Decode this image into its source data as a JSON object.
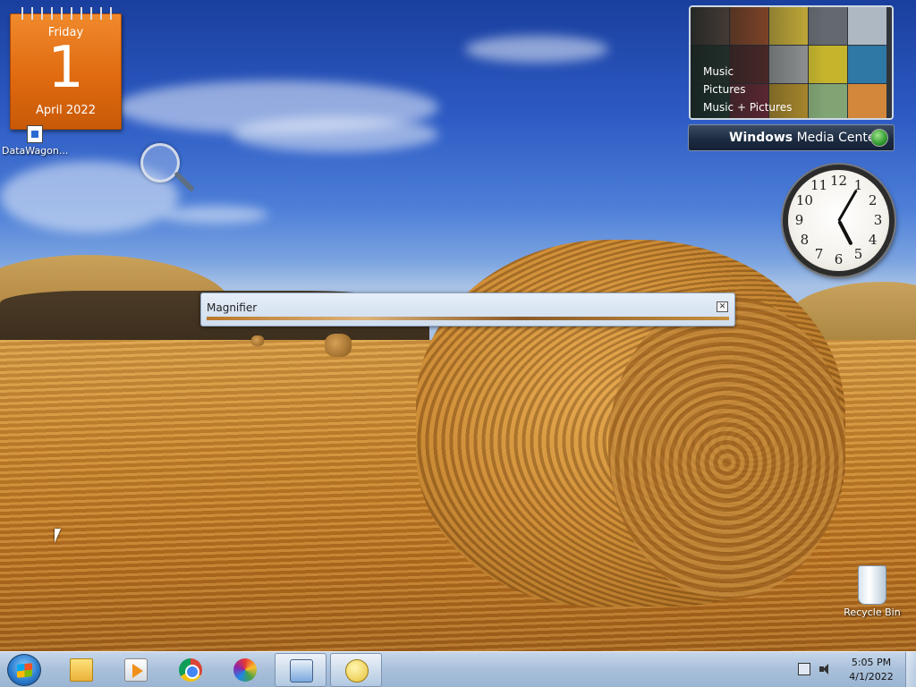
{
  "calendar": {
    "weekday": "Friday",
    "day": "1",
    "month_year": "April 2022"
  },
  "desktop_icons": {
    "datawagon": "DataWagon...",
    "recycle_bin": "Recycle Bin"
  },
  "media_center": {
    "menu": [
      "Music",
      "Pictures",
      "Music + Pictures"
    ],
    "brand_bold": "Windows",
    "brand_rest": " Media Center"
  },
  "clock_gadget": {
    "numbers": [
      "12",
      "1",
      "2",
      "3",
      "4",
      "5",
      "6",
      "7",
      "8",
      "9",
      "10",
      "11"
    ],
    "hour": 5,
    "minute": 5
  },
  "magnifier": {
    "title": "Magnifier",
    "close_glyph": "✕"
  },
  "taskbar": {
    "buttons": [
      {
        "name": "windows-explorer",
        "icon": "folder-icon"
      },
      {
        "name": "windows-media-player",
        "icon": "media-player-icon"
      },
      {
        "name": "google-chrome",
        "icon": "chrome-icon"
      },
      {
        "name": "photos-app",
        "icon": "pinwheel-icon"
      },
      {
        "name": "magnifier",
        "icon": "magnifier-icon",
        "active": true
      },
      {
        "name": "help-tips",
        "icon": "speech-bubble-icon",
        "active": true
      }
    ],
    "time": "5:05 PM",
    "date": "4/1/2022"
  },
  "colors": {
    "calendar_orange": "#e06a10",
    "taskbar_blue": "#a9c0da",
    "sky_blue": "#2d5bc4",
    "field_gold": "#c6822c"
  }
}
